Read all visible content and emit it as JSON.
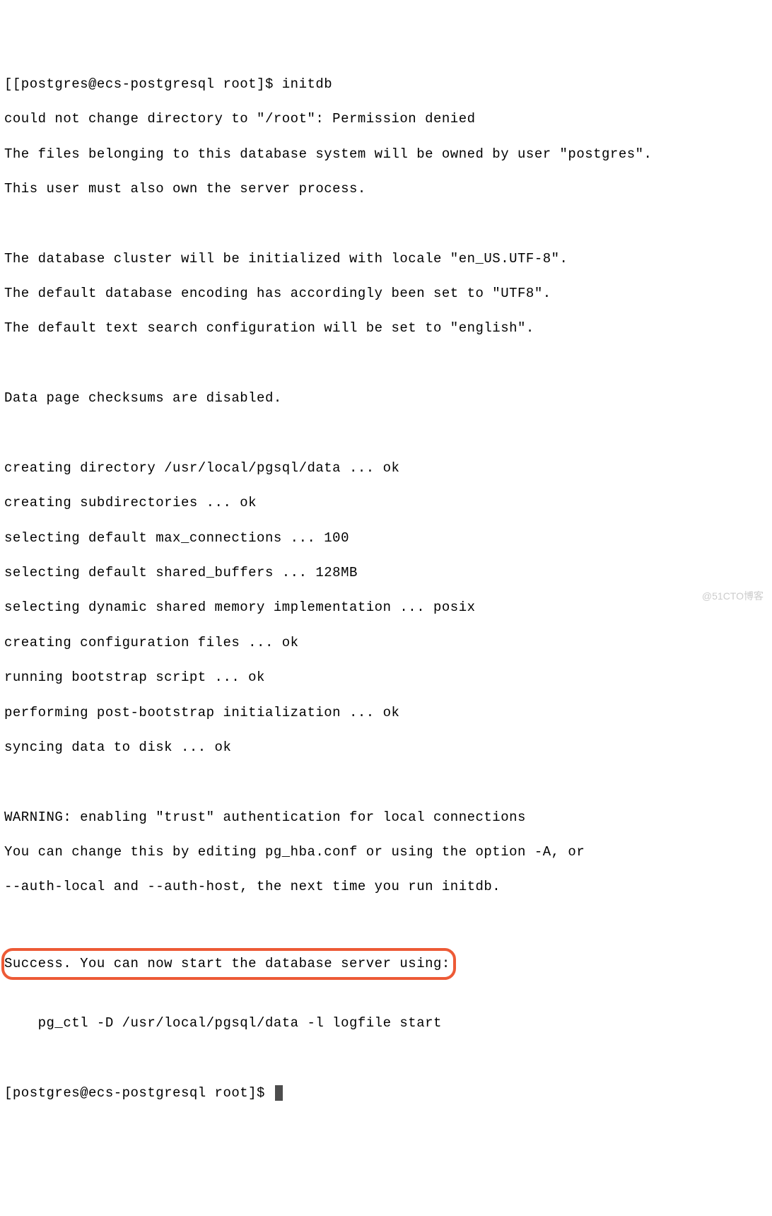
{
  "prompt1": "[[postgres@ecs-postgresql root]$ ",
  "command1": "initdb",
  "out": {
    "l1": "could not change directory to \"/root\": Permission denied",
    "l2": "The files belonging to this database system will be owned by user \"postgres\".",
    "l3": "This user must also own the server process.",
    "l4": "",
    "l5": "The database cluster will be initialized with locale \"en_US.UTF-8\".",
    "l6": "The default database encoding has accordingly been set to \"UTF8\".",
    "l7": "The default text search configuration will be set to \"english\".",
    "l8": "",
    "l9": "Data page checksums are disabled.",
    "l10": "",
    "l11": "creating directory /usr/local/pgsql/data ... ok",
    "l12": "creating subdirectories ... ok",
    "l13": "selecting default max_connections ... 100",
    "l14": "selecting default shared_buffers ... 128MB",
    "l15": "selecting dynamic shared memory implementation ... posix",
    "l16": "creating configuration files ... ok",
    "l17": "running bootstrap script ... ok",
    "l18": "performing post-bootstrap initialization ... ok",
    "l19": "syncing data to disk ... ok",
    "l20": "",
    "l21": "WARNING: enabling \"trust\" authentication for local connections",
    "l22": "You can change this by editing pg_hba.conf or using the option -A, or",
    "l23": "--auth-local and --auth-host, the next time you run initdb.",
    "l24": "",
    "l25": "Success. You can now start the database server using:",
    "l26": "",
    "l27": "    pg_ctl -D /usr/local/pgsql/data -l logfile start",
    "l28": ""
  },
  "prompt2": "[postgres@ecs-postgresql root]$ ",
  "watermark": "@51CTO博客"
}
